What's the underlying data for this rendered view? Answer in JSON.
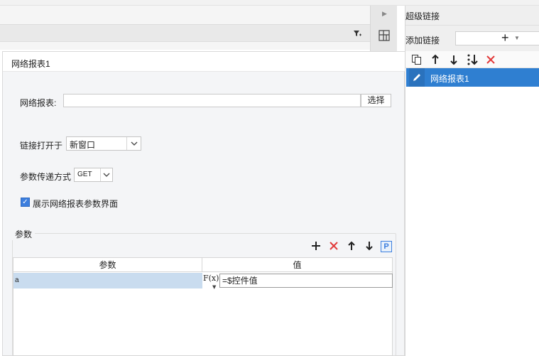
{
  "hyperlink_panel": {
    "title": "超级链接",
    "add_label": "添加链接",
    "add_symbol": "+",
    "items": [
      {
        "label": "网络报表1",
        "selected": true
      }
    ],
    "toolbar_icons": [
      "copy-icon",
      "arrow-up-icon",
      "arrow-down-icon",
      "sort-icon",
      "delete-icon"
    ]
  },
  "dialog": {
    "title": "网络报表1",
    "report_label": "网络报表:",
    "report_value": "",
    "select_button": "选择",
    "open_in_label": "链接打开于",
    "open_in_value": "新窗口",
    "param_method_label": "参数传递方式",
    "param_method_value": "GET",
    "show_params_label": "展示网络报表参数界面",
    "show_params_checked": true,
    "params_group_label": "参数",
    "params_toolbar_icons": [
      "add-icon",
      "delete-icon",
      "move-up-icon",
      "move-down-icon",
      "param-icon"
    ],
    "param_icon_letter": "P",
    "table": {
      "headers": [
        "参数",
        "值"
      ],
      "rows": [
        {
          "name": "a",
          "formula_label": "F(x)",
          "value": "=$控件值"
        }
      ]
    }
  },
  "colors": {
    "accent": "#2f7fd1",
    "delete_red": "#e23a3a",
    "row_highlight": "#c9dcef"
  }
}
